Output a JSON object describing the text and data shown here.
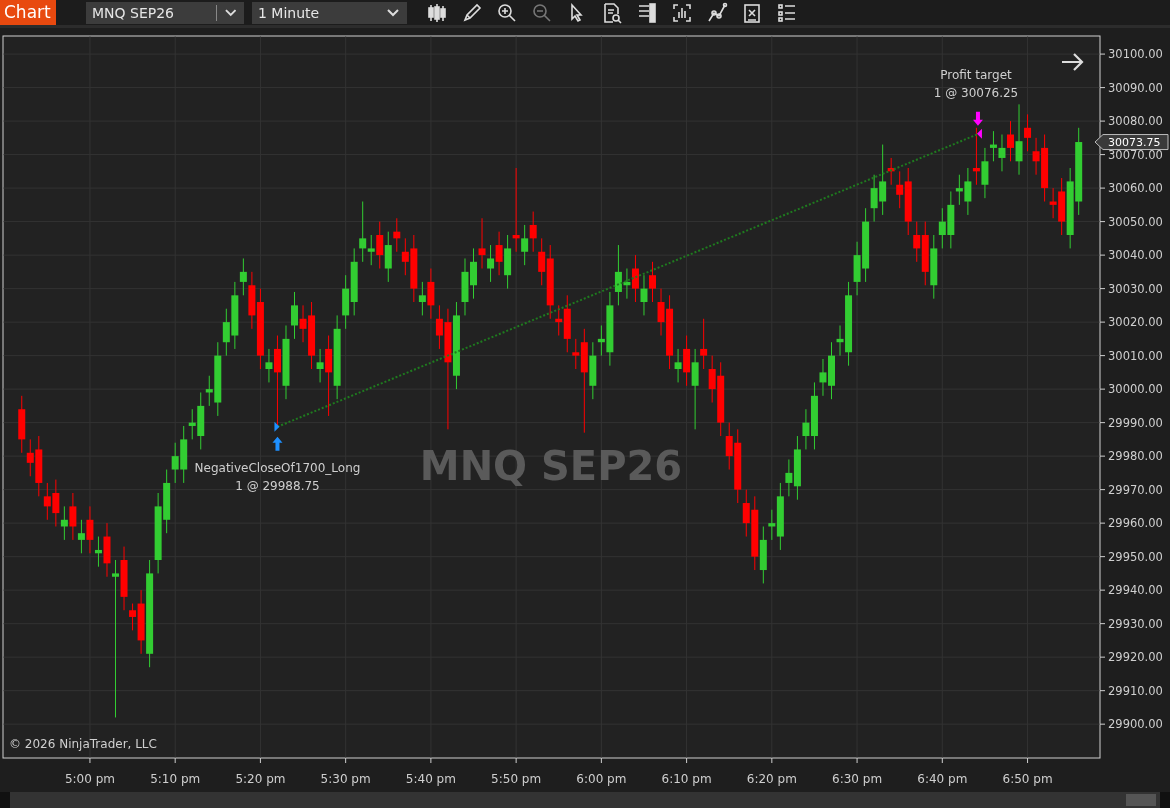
{
  "toolbar": {
    "title": "Chart",
    "instrument": "MNQ SEP26",
    "interval": "1 Minute"
  },
  "chart": {
    "watermark": "MNQ SEP26",
    "copyright": "© 2026 NinjaTrader, LLC",
    "last_price": "30073.75",
    "entry": {
      "label": "NegativeCloseOf1700_Long",
      "fill": "1 @ 29988.75"
    },
    "exit": {
      "label": "Profit target",
      "fill": "1 @ 30076.25"
    },
    "chart_data": {
      "type": "candlestick",
      "grid": true,
      "ylim": [
        29889.9,
        30105.4
      ],
      "yticks": [
        {
          "value": 30100,
          "label": "30100.00"
        },
        {
          "value": 30090,
          "label": "30090.00"
        },
        {
          "value": 30080,
          "label": "30080.00"
        },
        {
          "value": 30070,
          "label": "30070.00"
        },
        {
          "value": 30060,
          "label": "30060.00"
        },
        {
          "value": 30050,
          "label": "30050.00"
        },
        {
          "value": 30040,
          "label": "30040.00"
        },
        {
          "value": 30030,
          "label": "30030.00"
        },
        {
          "value": 30020,
          "label": "30020.00"
        },
        {
          "value": 30010,
          "label": "30010.00"
        },
        {
          "value": 30000,
          "label": "30000.00"
        },
        {
          "value": 29990,
          "label": "29990.00"
        },
        {
          "value": 29980,
          "label": "29980.00"
        },
        {
          "value": 29970,
          "label": "29970.00"
        },
        {
          "value": 29960,
          "label": "29960.00"
        },
        {
          "value": 29950,
          "label": "29950.00"
        },
        {
          "value": 29940,
          "label": "29940.00"
        },
        {
          "value": 29930,
          "label": "29930.00"
        },
        {
          "value": 29920,
          "label": "29920.00"
        },
        {
          "value": 29910,
          "label": "29910.00"
        },
        {
          "value": 29900,
          "label": "29900.00"
        }
      ],
      "categories": [
        null,
        null,
        null,
        null,
        null,
        null,
        null,
        null,
        "5:00 pm",
        null,
        null,
        null,
        null,
        null,
        null,
        null,
        null,
        null,
        "5:10 pm",
        null,
        null,
        null,
        null,
        null,
        null,
        null,
        null,
        null,
        "5:20 pm",
        null,
        null,
        null,
        null,
        null,
        null,
        null,
        null,
        null,
        "5:30 pm",
        null,
        null,
        null,
        null,
        null,
        null,
        null,
        null,
        null,
        "5:40 pm",
        null,
        null,
        null,
        null,
        null,
        null,
        null,
        null,
        null,
        "5:50 pm",
        null,
        null,
        null,
        null,
        null,
        null,
        null,
        null,
        null,
        "6:00 pm",
        null,
        null,
        null,
        null,
        null,
        null,
        null,
        null,
        null,
        "6:10 pm",
        null,
        null,
        null,
        null,
        null,
        null,
        null,
        null,
        null,
        "6:20 pm",
        null,
        null,
        null,
        null,
        null,
        null,
        null,
        null,
        null,
        "6:30 pm",
        null,
        null,
        null,
        null,
        null,
        null,
        null,
        null,
        null,
        "6:40 pm",
        null,
        null,
        null,
        null,
        null,
        null,
        null,
        null,
        null,
        "6:50 pm",
        null,
        null,
        null,
        null,
        null,
        null
      ],
      "ohlc": [
        [
          29994,
          29998,
          29981,
          29985
        ],
        [
          29981,
          29985,
          29974,
          29978
        ],
        [
          29982,
          29986,
          29968,
          29972
        ],
        [
          29968,
          29972,
          29961,
          29965
        ],
        [
          29969,
          29973,
          29959,
          29963
        ],
        [
          29959,
          29965,
          29955,
          29961
        ],
        [
          29965,
          29969,
          29955,
          29959
        ],
        [
          29955,
          29961,
          29951,
          29957
        ],
        [
          29961,
          29965,
          29951,
          29955
        ],
        [
          29951,
          29956,
          29947,
          29952
        ],
        [
          29956,
          29960,
          29944,
          29948
        ],
        [
          29944,
          29949,
          29902,
          29945
        ],
        [
          29949,
          29953,
          29934,
          29938
        ],
        [
          29934,
          29936,
          29928,
          29932
        ],
        [
          29936,
          29940,
          29921,
          29925
        ],
        [
          29921,
          29949,
          29917,
          29945
        ],
        [
          29949,
          29969,
          29945,
          29965
        ],
        [
          29961,
          29976,
          29957,
          29972
        ],
        [
          29976,
          29984,
          29972,
          29980
        ],
        [
          29976,
          29989,
          29972,
          29985
        ],
        [
          29989,
          29994,
          29985,
          29990
        ],
        [
          29986,
          29999,
          29982,
          29995
        ],
        [
          29999,
          30004,
          29995,
          30000
        ],
        [
          29996,
          30014,
          29992,
          30010
        ],
        [
          30014,
          30024,
          30010,
          30020
        ],
        [
          30016,
          30032,
          30012,
          30028
        ],
        [
          30032,
          30039,
          30028,
          30035
        ],
        [
          30031,
          30035,
          30018,
          30022
        ],
        [
          30026,
          30030,
          30006,
          30010
        ],
        [
          30006,
          30012,
          30002,
          30008
        ],
        [
          30012,
          30016,
          29989,
          30005
        ],
        [
          30001,
          30019,
          29997,
          30015
        ],
        [
          30019,
          30029,
          30015,
          30025
        ],
        [
          30021,
          30025,
          30014,
          30018
        ],
        [
          30022,
          30026,
          30006,
          30010
        ],
        [
          30006,
          30012,
          30002,
          30008
        ],
        [
          30012,
          30016,
          29992,
          30005
        ],
        [
          30001,
          30022,
          29997,
          30018
        ],
        [
          30022,
          30034,
          30018,
          30030
        ],
        [
          30026,
          30042,
          30022,
          30038
        ],
        [
          30042,
          30056,
          30038,
          30045
        ],
        [
          30041,
          30046,
          30037,
          30042
        ],
        [
          30046,
          30050,
          30036,
          30040
        ],
        [
          30036,
          30047,
          30032,
          30043
        ],
        [
          30047,
          30051,
          30041,
          30045
        ],
        [
          30041,
          30045,
          30034,
          30038
        ],
        [
          30042,
          30046,
          30026,
          30030
        ],
        [
          30026,
          30032,
          30022,
          30028
        ],
        [
          30032,
          30036,
          30021,
          30025
        ],
        [
          30021,
          30025,
          30012,
          30016
        ],
        [
          30020,
          30024,
          29988,
          30008
        ],
        [
          30004,
          30026,
          30000,
          30022
        ],
        [
          30026,
          30039,
          30022,
          30035
        ],
        [
          30031,
          30042,
          30027,
          30038
        ],
        [
          30042,
          30051,
          30036,
          30040
        ],
        [
          30036,
          30043,
          30032,
          30039
        ],
        [
          30043,
          30047,
          30034,
          30038
        ],
        [
          30034,
          30046,
          30030,
          30042
        ],
        [
          30046,
          30066,
          30041,
          30045
        ],
        [
          30041,
          30049,
          30037,
          30045
        ],
        [
          30049,
          30053,
          30041,
          30045
        ],
        [
          30041,
          30045,
          30031,
          30035
        ],
        [
          30039,
          30043,
          30021,
          30025
        ],
        [
          30021,
          30025,
          30016,
          30020
        ],
        [
          30024,
          30028,
          30011,
          30015
        ],
        [
          30011,
          30015,
          30006,
          30010
        ],
        [
          30014,
          30018,
          29987,
          30005
        ],
        [
          30001,
          30014,
          29997,
          30010
        ],
        [
          30014,
          30019,
          30010,
          30015
        ],
        [
          30011,
          30029,
          30007,
          30025
        ],
        [
          30029,
          30043,
          30025,
          30035
        ],
        [
          30031,
          30036,
          30027,
          30032
        ],
        [
          30036,
          30040,
          30026,
          30030
        ],
        [
          30026,
          30034,
          30022,
          30030
        ],
        [
          30034,
          30038,
          30026,
          30030
        ],
        [
          30026,
          30030,
          30016,
          30020
        ],
        [
          30024,
          30028,
          30006,
          30010
        ],
        [
          30006,
          30012,
          30002,
          30008
        ],
        [
          30012,
          30016,
          30001,
          30005
        ],
        [
          30001,
          30012,
          29988,
          30008
        ],
        [
          30012,
          30021,
          30006,
          30010
        ],
        [
          30006,
          30010,
          29996,
          30000
        ],
        [
          30004,
          30008,
          29986,
          29990
        ],
        [
          29986,
          29990,
          29976,
          29980
        ],
        [
          29984,
          29988,
          29966,
          29970
        ],
        [
          29966,
          29970,
          29956,
          29960
        ],
        [
          29964,
          29968,
          29946,
          29950
        ],
        [
          29946,
          29959,
          29942,
          29955
        ],
        [
          29959,
          29964,
          29955,
          29960
        ],
        [
          29956,
          29972,
          29952,
          29968
        ],
        [
          29972,
          29979,
          29968,
          29975
        ],
        [
          29971,
          29986,
          29967,
          29982
        ],
        [
          29986,
          29994,
          29982,
          29990
        ],
        [
          29986,
          30002,
          29982,
          29998
        ],
        [
          30002,
          30009,
          29998,
          30005
        ],
        [
          30001,
          30014,
          29997,
          30010
        ],
        [
          30014,
          30019,
          30010,
          30015
        ],
        [
          30011,
          30032,
          30007,
          30028
        ],
        [
          30032,
          30044,
          30028,
          30040
        ],
        [
          30036,
          30054,
          30032,
          30050
        ],
        [
          30054,
          30064,
          30050,
          30060
        ],
        [
          30056,
          30073,
          30052,
          30062
        ],
        [
          30066,
          30069,
          30061,
          30065
        ],
        [
          30061,
          30065,
          30054,
          30058
        ],
        [
          30062,
          30066,
          30046,
          30050
        ],
        [
          30046,
          30050,
          30038,
          30042
        ],
        [
          30046,
          30050,
          30031,
          30035
        ],
        [
          30031,
          30046,
          30027,
          30042
        ],
        [
          30046,
          30054,
          30042,
          30050
        ],
        [
          30046,
          30059,
          30042,
          30055
        ],
        [
          30059,
          30064,
          30055,
          30060
        ],
        [
          30056,
          30066,
          30052,
          30062
        ],
        [
          30066,
          30078,
          30061,
          30065
        ],
        [
          30061,
          30072,
          30057,
          30068
        ],
        [
          30072,
          30077,
          30068,
          30073
        ],
        [
          30069,
          30076,
          30065,
          30072
        ],
        [
          30076,
          30080,
          30068,
          30072
        ],
        [
          30068,
          30085,
          30064,
          30074
        ],
        [
          30078,
          30082,
          30071,
          30075
        ],
        [
          30071,
          30075,
          30064,
          30068
        ],
        [
          30072,
          30076,
          30056,
          30060
        ],
        [
          30056,
          30060,
          30051,
          30055
        ],
        [
          30059,
          30063,
          30046,
          30050
        ],
        [
          30046,
          30066,
          30042,
          30062
        ],
        [
          30056,
          30078,
          30052,
          30073.75
        ]
      ]
    }
  }
}
